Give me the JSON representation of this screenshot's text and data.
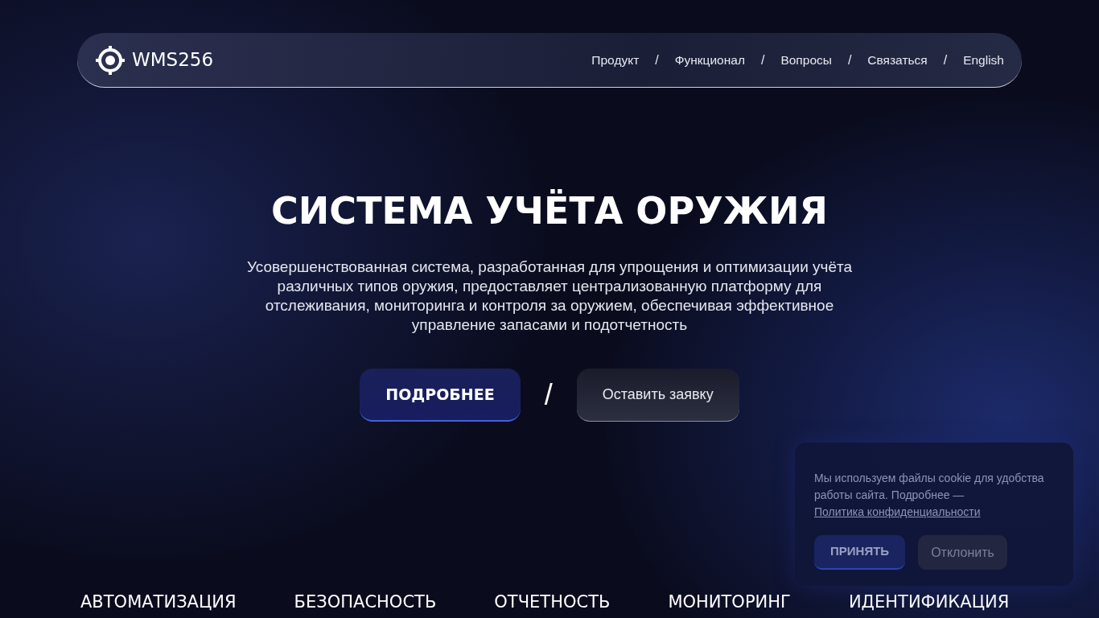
{
  "brand": {
    "name": "WMS256"
  },
  "nav": {
    "items": [
      {
        "label": "Продукт"
      },
      {
        "label": "Функционал"
      },
      {
        "label": "Вопросы"
      },
      {
        "label": "Связаться"
      },
      {
        "label": "English"
      }
    ],
    "separator": "/"
  },
  "hero": {
    "title": "СИСТЕМА УЧЁТА ОРУЖИЯ",
    "description": "Усовершенствованная система, разработанная для упрощения и оптимизации учёта различных типов оружия, предоставляет централизованную платформу для отслеживания, мониторинга и контроля за оружием, обеспечивая эффективное управление запасами и подотчетность",
    "primary_button": "ПОДРОБНЕЕ",
    "separator": "/",
    "secondary_button": "Оставить заявку"
  },
  "features": [
    "АВТОМАТИЗАЦИЯ",
    "БЕЗОПАСНОСТЬ",
    "ОТЧЕТНОСТЬ",
    "МОНИТОРИНГ",
    "ИДЕНТИФИКАЦИЯ"
  ],
  "cookie_banner": {
    "text": "Мы используем файлы cookie для удобства работы сайта. Подробнее — ",
    "link": "Политика конфиденциальности",
    "accept": "ПРИНЯТЬ",
    "decline": "Отклонить"
  }
}
